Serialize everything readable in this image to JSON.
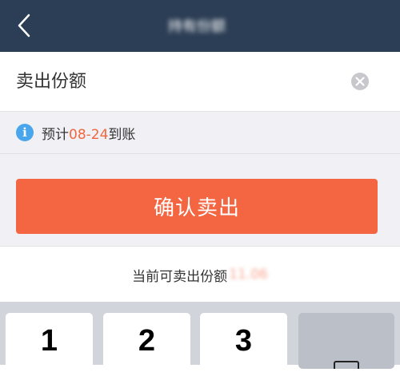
{
  "header": {
    "title": "持有份额"
  },
  "amount": {
    "placeholder": "卖出份额",
    "value": ""
  },
  "info": {
    "icon_glyph": "i",
    "prefix": "预计",
    "date": "08-24",
    "suffix": "到账"
  },
  "confirm_button": {
    "label": "确认卖出"
  },
  "available": {
    "label": "当前可卖出份额",
    "value": "11.06"
  },
  "keypad": {
    "keys": [
      "1",
      "2",
      "3"
    ]
  },
  "colors": {
    "header_bg": "#2c3e55",
    "accent": "#f46542",
    "info_blue": "#4aa6ec",
    "date_orange": "#f2663f"
  },
  "icons": [
    "back-arrow-icon",
    "clear-icon",
    "info-icon",
    "backspace-icon"
  ]
}
